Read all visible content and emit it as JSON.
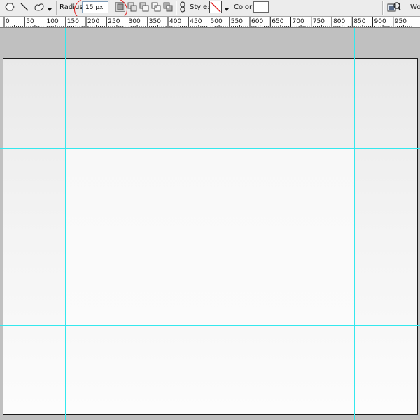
{
  "options_bar": {
    "radius_label": "Radius:",
    "radius_value": "15 px",
    "style_label": "Style:",
    "color_label": "Color:",
    "workspace_label": "Wo",
    "icons": {
      "polygon_tool": "polygon-icon",
      "line_tool": "line-icon",
      "custom_shape_tool": "custom-shape-icon",
      "tool_dropdown": "chevron-down-icon",
      "new_shape_layer": "new-shape-layer-icon",
      "add_to_area": "add-to-shape-area-icon",
      "subtract_from_area": "subtract-from-shape-area-icon",
      "intersect_areas": "intersect-shape-areas-icon",
      "exclude_overlap": "exclude-overlapping-areas-icon",
      "link": "link-icon",
      "style_none": "no-style-swatch-icon",
      "style_dropdown": "chevron-down-icon",
      "workspace": "workspace-icon"
    },
    "swatch_color": "#ffffff",
    "annotation_color": "#e01818"
  },
  "ruler": {
    "unit": "px",
    "labels": [
      "0",
      "50",
      "100",
      "150",
      "200",
      "250",
      "300",
      "350",
      "400",
      "450",
      "500",
      "550",
      "600",
      "650",
      "700",
      "750",
      "800",
      "850",
      "900",
      "950"
    ]
  },
  "canvas": {
    "guide_color": "#33e8ee",
    "background_top": "#e9e9e9",
    "background_bottom": "#fcfcfc"
  }
}
